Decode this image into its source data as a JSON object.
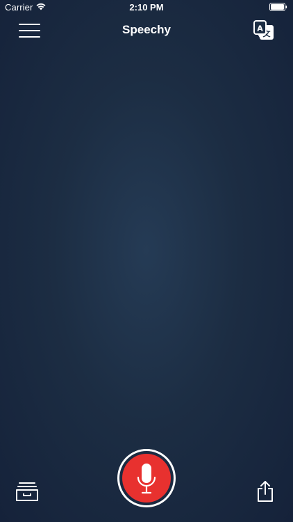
{
  "status_bar": {
    "carrier": "Carrier",
    "time": "2:10 PM",
    "wifi_icon": "wifi-icon",
    "battery_icon": "battery-icon"
  },
  "nav_bar": {
    "title": "Speechy",
    "menu_icon": "hamburger-menu-icon",
    "translate_icon": "translate-icon"
  },
  "bottom_bar": {
    "archive_icon": "archive-tray-icon",
    "record_icon": "microphone-icon",
    "share_icon": "share-icon"
  },
  "colors": {
    "background_center": "#253b55",
    "background_edge": "#15223a",
    "record_red": "#e8312f",
    "foreground": "#ffffff"
  }
}
